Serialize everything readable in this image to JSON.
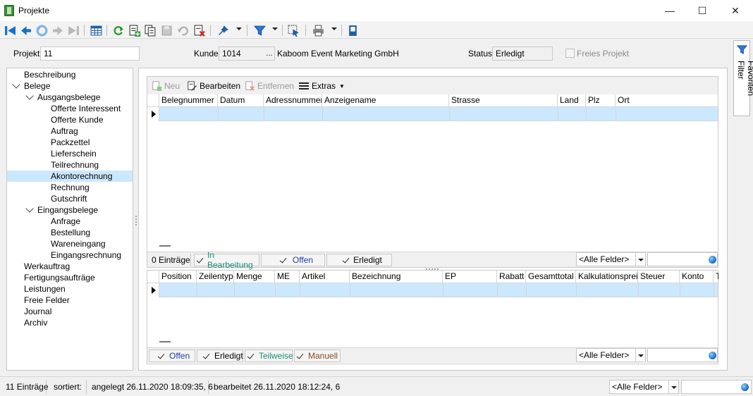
{
  "window": {
    "title": "Projekte",
    "minimize": "—",
    "maximize": "☐",
    "close": "✕"
  },
  "toolbar": {
    "icons": [
      "first-record",
      "previous-record",
      "back-circle",
      "next-record",
      "last-record",
      "table-view",
      "refresh",
      "new-record",
      "copy-record",
      "save-record",
      "undo",
      "delete-record",
      "pin",
      "filter",
      "cursor-select",
      "print",
      "layout"
    ]
  },
  "header": {
    "projekt_label": "Projekt",
    "projekt_value": "11",
    "kunde_label": "Kunde",
    "kunde_value": "1014",
    "kunde_button": "...",
    "kunde_name": "Kaboom Event Marketing GmbH",
    "status_label": "Status",
    "status_value": "Erledigt",
    "freies_projekt_label": "Freies Projekt"
  },
  "tree": {
    "items": [
      {
        "label": "Beschreibung"
      },
      {
        "label": "Belege"
      },
      {
        "label": "Ausgangsbelege"
      },
      {
        "label": "Offerte Interessent"
      },
      {
        "label": "Offerte Kunde"
      },
      {
        "label": "Auftrag"
      },
      {
        "label": "Packzettel"
      },
      {
        "label": "Lieferschein"
      },
      {
        "label": "Teilrechnung"
      },
      {
        "label": "Akontorechnung"
      },
      {
        "label": "Rechnung"
      },
      {
        "label": "Gutschrift"
      },
      {
        "label": "Eingangsbelege"
      },
      {
        "label": "Anfrage"
      },
      {
        "label": "Bestellung"
      },
      {
        "label": "Wareneingang"
      },
      {
        "label": "Eingangsrechnung"
      },
      {
        "label": "Werkauftrag"
      },
      {
        "label": "Fertigungsaufträge"
      },
      {
        "label": "Leistungen"
      },
      {
        "label": "Freie Felder"
      },
      {
        "label": "Journal"
      },
      {
        "label": "Archiv"
      }
    ],
    "selected": "Akontorechnung"
  },
  "grid_toolbar": {
    "neu": "Neu",
    "bearbeiten": "Bearbeiten",
    "entfernen": "Entfernen",
    "extras": "Extras"
  },
  "upper_grid": {
    "columns": [
      "Belegnummer",
      "Datum",
      "Adressnummer",
      "Anzeigename",
      "Strasse",
      "Land",
      "Plz",
      "Ort"
    ],
    "count": "0 Einträge",
    "filters": [
      {
        "label": "In Bearbeitung",
        "color": "#1a8a7a"
      },
      {
        "label": "Offen",
        "color": "#1f3f9f"
      },
      {
        "label": "Erledigt",
        "color": "#000000"
      }
    ],
    "combo": "<Alle Felder>"
  },
  "lower_grid": {
    "columns": [
      "Position",
      "Zeilentyp",
      "Menge",
      "ME",
      "Artikel",
      "Bezeichnung",
      "EP",
      "Rabatt",
      "Gesamttotal",
      "Kalkulationspreis",
      "Steuer",
      "Konto",
      "T"
    ],
    "filters": [
      {
        "label": "Offen",
        "color": "#1f3f9f"
      },
      {
        "label": "Erledigt",
        "color": "#000000"
      },
      {
        "label": "Teilweise",
        "color": "#1a8a7a"
      },
      {
        "label": "Manuell",
        "color": "#8a4a1a"
      }
    ],
    "combo": "<Alle Felder>"
  },
  "favorites": {
    "label": "Favoriten Filter"
  },
  "statusbar": {
    "count": "11 Einträge",
    "sorted": "sortiert:",
    "created": "angelegt 26.11.2020 18:09:35,  6",
    "edited": "bearbeitet 26.11.2020 18:12:24,  6",
    "combo": "<Alle Felder>"
  }
}
